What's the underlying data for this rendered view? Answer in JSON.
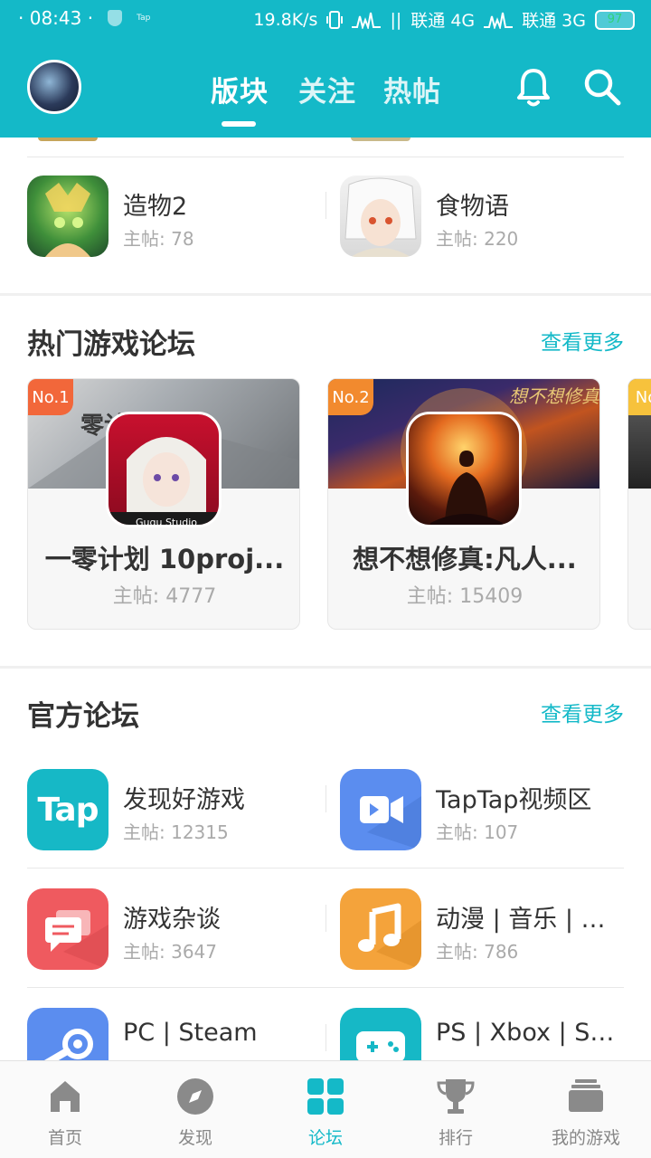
{
  "status_bar": {
    "time": "· 08:43 ·",
    "mini_label": "Tap",
    "speed": "19.8K/s",
    "carrier1": "联通 4G",
    "carrier2": "联通 3G",
    "battery": "97"
  },
  "header": {
    "tabs": [
      {
        "label": "版块",
        "active": true
      },
      {
        "label": "关注",
        "active": false
      },
      {
        "label": "热帖",
        "active": false
      }
    ],
    "accent_color": "#14b9c8"
  },
  "top_forums": [
    {
      "name": "造物2",
      "posts": "主帖: 78"
    },
    {
      "name": "食物语",
      "posts": "主帖: 220"
    }
  ],
  "hot_section": {
    "title": "热门游戏论坛",
    "more": "查看更多",
    "cards": [
      {
        "rank": "No.1",
        "name": "一零计划 10proj...",
        "posts": "主帖: 4777",
        "icon_caption": "Gugu Studio"
      },
      {
        "rank": "No.2",
        "name": "想不想修真:凡人...",
        "posts": "主帖: 15409"
      },
      {
        "rank": "No"
      }
    ]
  },
  "official_section": {
    "title": "官方论坛",
    "more": "查看更多",
    "forums": [
      {
        "name": "发现好游戏",
        "posts": "主帖: 12315",
        "icon": "tap-logo-icon",
        "icon_text": "Tap",
        "color": "#16b8c6"
      },
      {
        "name": "TapTap视频区",
        "posts": "主帖: 107",
        "icon": "video-camera-icon",
        "color": "#5b8def"
      },
      {
        "name": "游戏杂谈",
        "posts": "主帖: 3647",
        "icon": "chat-bubble-icon",
        "color": "#ef5a5f"
      },
      {
        "name": "动漫 | 音乐 | 影...",
        "posts": "主帖: 786",
        "icon": "music-note-icon",
        "color": "#f4a33b"
      },
      {
        "name": "PC | Steam",
        "icon": "steam-icon",
        "color": "#5b8def"
      },
      {
        "name": "PS | Xbox | Swi...",
        "icon": "gamepad-icon",
        "color": "#16b8c6"
      }
    ]
  },
  "bottom_nav": [
    {
      "label": "首页",
      "icon": "home-icon",
      "active": false
    },
    {
      "label": "发现",
      "icon": "compass-icon",
      "active": false
    },
    {
      "label": "论坛",
      "icon": "forum-grid-icon",
      "active": true
    },
    {
      "label": "排行",
      "icon": "trophy-icon",
      "active": false
    },
    {
      "label": "我的游戏",
      "icon": "game-stack-icon",
      "active": false
    }
  ]
}
